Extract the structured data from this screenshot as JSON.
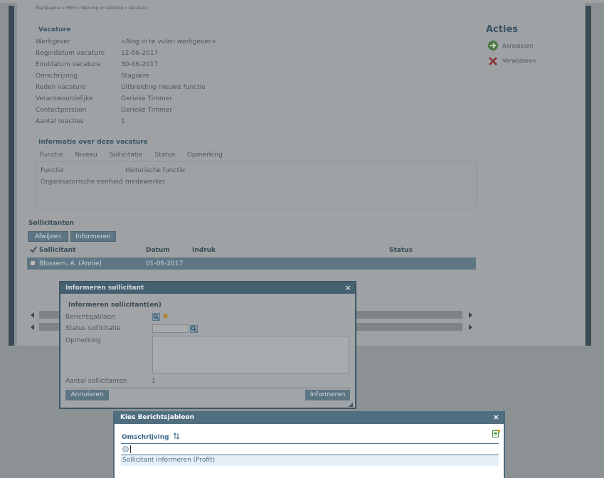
{
  "breadcrumb": "Startpagina » HRM » Werving en selectie » Vacature",
  "vacature": {
    "title": "Vacature",
    "fields": [
      {
        "label": "Werkgever",
        "value": "<Nog in te vulen werkgever>"
      },
      {
        "label": "Begindatum vacature",
        "value": "12-06-2017"
      },
      {
        "label": "Einddatum vacature",
        "value": "30-06-2017"
      },
      {
        "label": "Omschrijving",
        "value": "Stagiaire"
      },
      {
        "label": "Reden vacature",
        "value": "Uitbreiding nieuwe functie"
      },
      {
        "label": "Verantwoordelijke",
        "value": "Gerieke Timmer"
      },
      {
        "label": "Contactpersoon",
        "value": "Gerieke Timmer"
      },
      {
        "label": "Aantal reacties",
        "value": "1"
      }
    ]
  },
  "info": {
    "title": "Informatie over deze vacature",
    "tabs": [
      "Functie",
      "Niveau",
      "Sollicitatie",
      "Status",
      "Opmerking"
    ],
    "rows": [
      {
        "label": "Functie",
        "value": "Historische functie"
      },
      {
        "label": "Organisatorische eenheid",
        "value": "medewerker"
      }
    ]
  },
  "acties": {
    "title": "Acties",
    "items": [
      {
        "label": "Aanpassen",
        "icon": "arrow-right-icon"
      },
      {
        "label": "Verwijderen",
        "icon": "delete-x-icon"
      }
    ]
  },
  "sollicitanten": {
    "title": "Sollicitanten",
    "buttons": {
      "reject": "Afwijzen",
      "inform": "Informeren"
    },
    "columns": [
      "Sollicitant",
      "Datum",
      "Indruk",
      "Status"
    ],
    "rows": [
      {
        "name": "Blossem, A. (Annie)",
        "date": "01-06-2017",
        "impression": "",
        "status": ""
      }
    ]
  },
  "dialog_inform": {
    "title": "Informeren sollicitant",
    "close": "×",
    "subtitle": "Informeren sollicitant(en)",
    "labels": {
      "template": "Berichtsjabloon",
      "status": "Status sollicitatie",
      "remark": "Opmerking",
      "count": "Aantal sollicitanten"
    },
    "count_value": "1",
    "cancel": "Annuleren",
    "submit": "Informeren"
  },
  "dialog_template": {
    "title": "Kies Berichtsjabloon",
    "close": "×",
    "column": "Omschrijving",
    "filter_value": "",
    "rows": [
      "Sollicitant informeren (Profit)"
    ]
  },
  "colors": {
    "header_dark": "#45606f",
    "accent_green": "#4aa84a",
    "accent_red": "#cc2b2b"
  }
}
